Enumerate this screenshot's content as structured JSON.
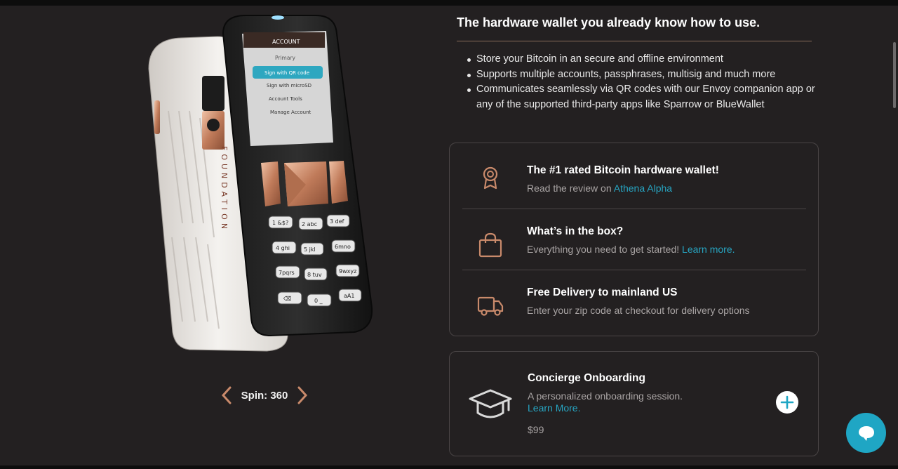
{
  "product": {
    "screen_header": "ACCOUNT",
    "screen_account": "Primary",
    "screen_menu": [
      "Sign with QR code",
      "Sign with microSD",
      "Account Tools",
      "Manage Account"
    ],
    "brand_lettering": "FOUNDATION",
    "keypad": [
      "1 &$?",
      "2 abc",
      "3 def",
      "4 ghi",
      "5 jkl",
      "6 mno",
      "7 pqrs",
      "8 tuv",
      "9 wxyz",
      "⌫",
      "0 _",
      "aA1"
    ],
    "spin_label": "Spin: 360",
    "prev_icon": "chevron-left-icon",
    "next_icon": "chevron-right-icon"
  },
  "headline": "The hardware wallet you already know how to use.",
  "features": [
    "Store your Bitcoin in an secure and offline environment",
    "Supports multiple accounts, passphrases, multisig and much more",
    "Communicates seamlessly via QR codes with our Envoy companion app or any of the supported third-party apps like Sparrow or BlueWallet"
  ],
  "info_rows": [
    {
      "icon": "award-ribbon-icon",
      "title": "The #1 rated Bitcoin hardware wallet!",
      "sub": "Read the review on ",
      "link": "Athena Alpha"
    },
    {
      "icon": "shopping-bag-icon",
      "title": "What’s in the box?",
      "sub": "Everything you need to get started! ",
      "link": "Learn more."
    },
    {
      "icon": "delivery-truck-icon",
      "title": "Free Delivery to mainland US",
      "sub": "Enter your zip code at checkout for delivery options"
    }
  ],
  "concierge": {
    "icon": "graduation-cap-icon",
    "title": "Concierge Onboarding",
    "sub": "A personalized onboarding session.",
    "link": "Learn More.",
    "price": "$99",
    "add_icon": "plus-circle-icon"
  },
  "chat": {
    "icon": "chat-bubble-icon"
  },
  "colors": {
    "background": "#232021",
    "accent_copper": "#c98a6b",
    "link": "#27a5c2",
    "chat": "#1fa6c4"
  }
}
